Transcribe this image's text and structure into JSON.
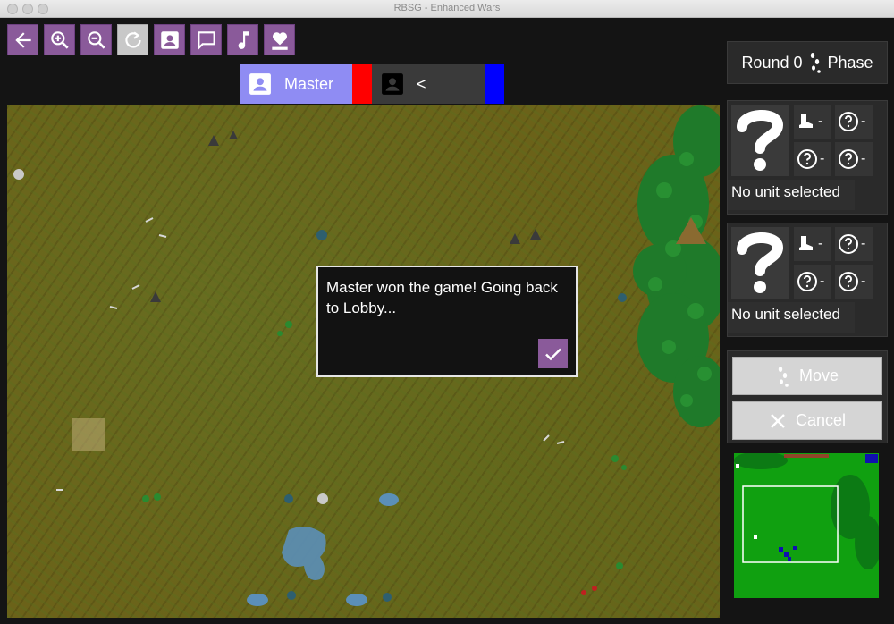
{
  "window": {
    "title": "RBSG - Enhanced Wars"
  },
  "toolbar": {
    "buttons": [
      {
        "icon": "back-arrow-icon",
        "enabled": true
      },
      {
        "icon": "zoom-in-icon",
        "enabled": true
      },
      {
        "icon": "zoom-out-icon",
        "enabled": true
      },
      {
        "icon": "refresh-icon",
        "enabled": false
      },
      {
        "icon": "profile-icon",
        "enabled": true
      },
      {
        "icon": "chat-icon",
        "enabled": true
      },
      {
        "icon": "music-icon",
        "enabled": true
      },
      {
        "icon": "heart-health-icon",
        "enabled": true
      }
    ]
  },
  "players": [
    {
      "name": "Master",
      "color": "#ff0000",
      "active": true
    },
    {
      "name": "<",
      "color": "#0000ff",
      "active": false
    }
  ],
  "dialog": {
    "message": "Master won the game! Going back to Lobby...",
    "confirm_icon": "checkmark-icon"
  },
  "round": {
    "label": "Round 0",
    "phase_icon": "footsteps-icon",
    "phase": "Phase"
  },
  "unit_panels": [
    {
      "label": "No unit selected",
      "stats": [
        "-",
        "-",
        "-",
        "-"
      ]
    },
    {
      "label": "No unit selected",
      "stats": [
        "-",
        "-",
        "-",
        "-"
      ]
    }
  ],
  "actions": {
    "move_label": "Move",
    "cancel_label": "Cancel"
  },
  "colors": {
    "accent": "#8a5a9a",
    "active_player_tab": "#8f8cf3",
    "player1": "#ff0000",
    "player2": "#0000ff",
    "minimap_ground": "#10a010"
  }
}
